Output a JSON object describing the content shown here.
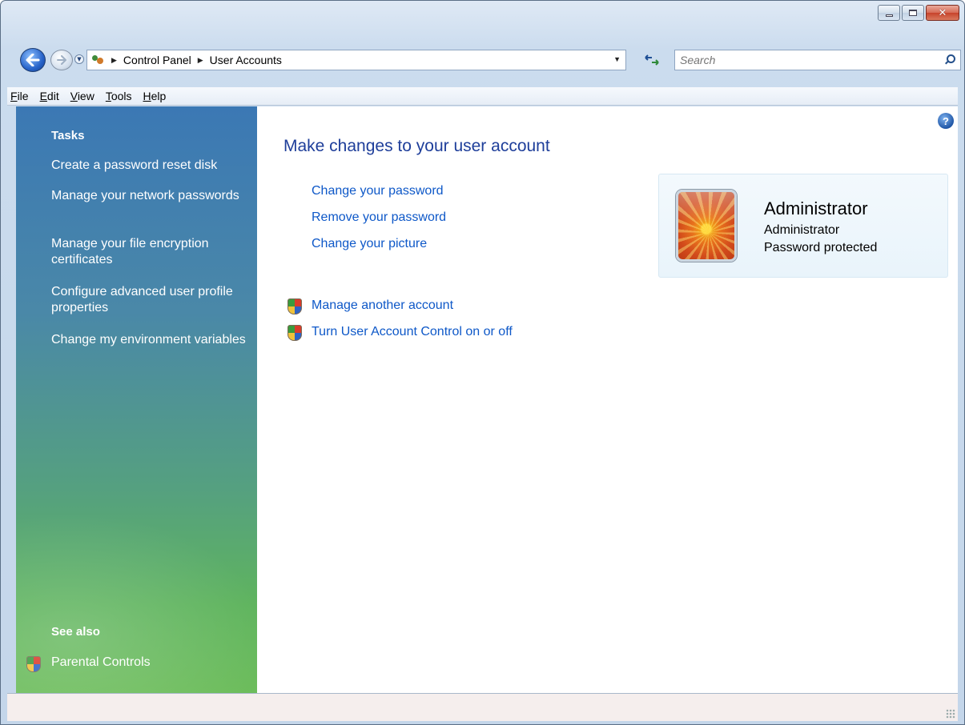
{
  "window": {
    "caption_buttons": {
      "minimize_icon": "minimize-icon",
      "maximize_icon": "maximize-icon",
      "close_glyph": "✕"
    }
  },
  "navigation": {
    "back_icon": "back-arrow-icon",
    "forward_icon": "forward-arrow-icon",
    "address_icon": "user-accounts-icon",
    "breadcrumbs": [
      "Control Panel",
      "User Accounts"
    ],
    "search_placeholder": "Search"
  },
  "menubar": {
    "items": [
      {
        "accel": "F",
        "rest": "ile"
      },
      {
        "accel": "E",
        "rest": "dit"
      },
      {
        "accel": "V",
        "rest": "iew"
      },
      {
        "accel": "T",
        "rest": "ools"
      },
      {
        "accel": "H",
        "rest": "elp"
      }
    ]
  },
  "sidebar": {
    "tasks_heading": "Tasks",
    "tasks": [
      "Create a password reset disk",
      "Manage your network passwords",
      "Manage your file encryption certificates",
      "Configure advanced user profile properties",
      "Change my environment variables"
    ],
    "see_also_heading": "See also",
    "see_also_link": "Parental Controls"
  },
  "main": {
    "help_glyph": "?",
    "title": "Make changes to your user account",
    "links": [
      "Change your password",
      "Remove your password",
      "Change your picture"
    ],
    "admin_links": [
      "Manage another account",
      "Turn User Account Control on or off"
    ],
    "account": {
      "name": "Administrator",
      "type": "Administrator",
      "status": "Password protected"
    }
  },
  "colors": {
    "link": "#0e58c8",
    "title": "#1e3e9a",
    "sidebar_top": "#3b78b4",
    "sidebar_bottom": "#6dbd5c"
  }
}
